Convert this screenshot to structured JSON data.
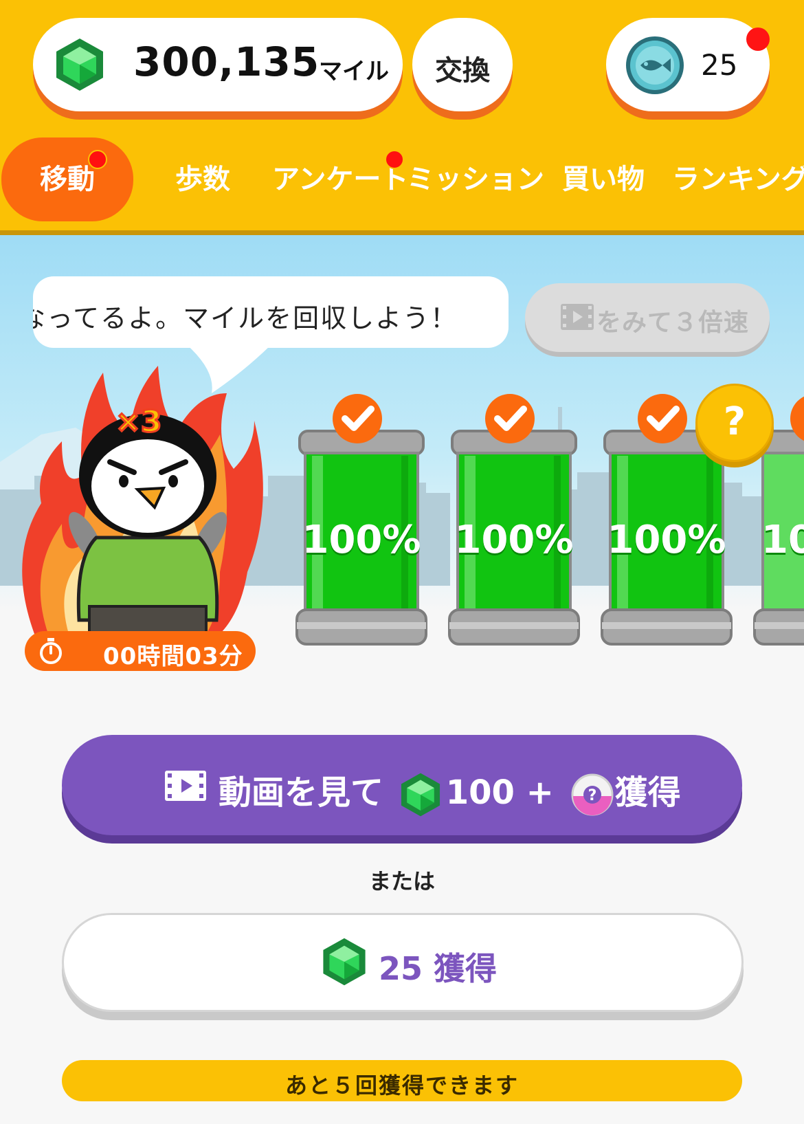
{
  "header": {
    "miles_value": "300,135",
    "miles_unit": "マイル",
    "exchange_label": "交換",
    "coin_count": "25"
  },
  "tabs": [
    {
      "label": "移動",
      "active": true,
      "badge": true
    },
    {
      "label": "歩数",
      "active": false,
      "badge": false
    },
    {
      "label": "アンケート",
      "active": false,
      "badge": true
    },
    {
      "label": "ミッション",
      "active": false,
      "badge": false
    },
    {
      "label": "買い物",
      "active": false,
      "badge": false
    },
    {
      "label": "ランキング",
      "active": false,
      "badge": false
    }
  ],
  "scene": {
    "bubble_text": "なってるよ。マイルを回収しよう！",
    "triple_label": "をみて３倍速",
    "multiplier": "×3",
    "timer_text": "00時間03分",
    "tanks": [
      {
        "percent": "100%",
        "status": "check"
      },
      {
        "percent": "100%",
        "status": "check"
      },
      {
        "percent": "100%",
        "status": "check"
      },
      {
        "percent": "10",
        "status": "bonus"
      }
    ],
    "bonus_mark": "?"
  },
  "actions": {
    "video_prefix": "動画を見て",
    "video_amount": "100 +",
    "video_suffix": "獲得",
    "or_label": "または",
    "get_amount": "25",
    "get_suffix": "獲得",
    "remaining_text": "あと５回獲得できます"
  },
  "colors": {
    "header_bg": "#fbc105",
    "accent_orange": "#fb6a0e",
    "purple": "#7c55be",
    "tank_green": "#11c411",
    "badge_red": "#ff1414"
  },
  "icons": [
    "emerald-icon",
    "fish-coin-icon",
    "play-film-icon",
    "mystery-capsule-icon",
    "stopwatch-icon",
    "checkmark-icon"
  ]
}
